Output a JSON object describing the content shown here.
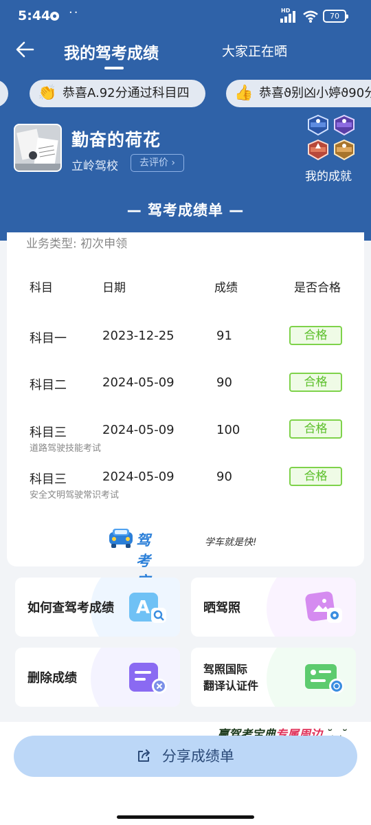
{
  "status_bar": {
    "time": "5:44",
    "more": "··",
    "network": "HD",
    "battery": "70"
  },
  "nav": {
    "title": "我的驾考成绩",
    "tab2": "大家正在晒"
  },
  "ticker": [
    {
      "emoji": "👏",
      "text": "恭喜A.92分通过科目四"
    },
    {
      "emoji": "👍",
      "text": "恭喜ϑ别凶小婷ϑ90分"
    }
  ],
  "user": {
    "name": "勤奋的荷花",
    "school": "立岭驾校",
    "rate_label": "去评价 ›",
    "achievements_label": "我的成就"
  },
  "section_title": "— 驾考成绩单 —",
  "scorecard": {
    "business_type": "业务类型: 初次申领",
    "headers": {
      "subject": "科目",
      "date": "日期",
      "score": "成绩",
      "passed": "是否合格"
    },
    "rows": [
      {
        "subject": "科目一",
        "date": "2023-12-25",
        "score": "91",
        "status": "合格",
        "note": ""
      },
      {
        "subject": "科目二",
        "date": "2024-05-09",
        "score": "90",
        "status": "合格",
        "note": ""
      },
      {
        "subject": "科目三",
        "date": "2024-05-09",
        "score": "100",
        "status": "合格",
        "note": "道路驾驶技能考试"
      },
      {
        "subject": "科目三",
        "date": "2024-05-09",
        "score": "90",
        "status": "合格",
        "note": "安全文明驾驶常识考试"
      }
    ],
    "brand": "驾考宝典",
    "slogan": "学车就是快!"
  },
  "tiles": {
    "query": "如何查驾考成绩",
    "show_license": "晒驾照",
    "delete": "删除成绩",
    "translate_line1": "驾照国际",
    "translate_line2": "翻译认证件"
  },
  "promo": {
    "prefix": "赢驾考宝典",
    "highlight": "专属周边"
  },
  "share_label": "分享成绩单",
  "colors": {
    "header_blue": "#2f62a8",
    "pass_green": "#5bbf2a",
    "share_button": "#bcd7f7"
  }
}
